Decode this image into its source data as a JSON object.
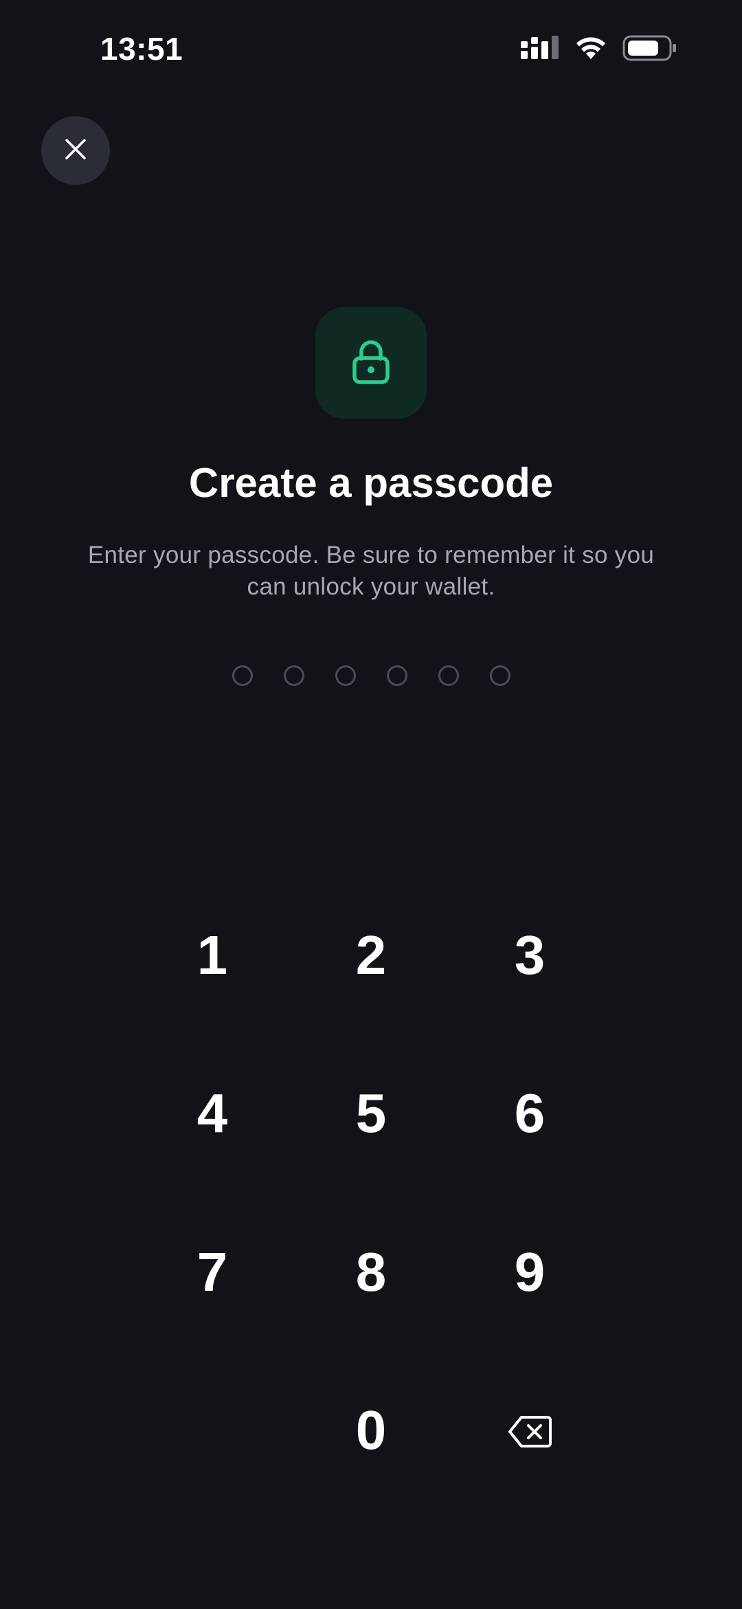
{
  "status_bar": {
    "time": "13:51",
    "icons": [
      "signal-icon",
      "wifi-icon",
      "battery-icon"
    ]
  },
  "header": {
    "close_icon": "close-icon"
  },
  "badge": {
    "icon": "lock-icon",
    "accent_color": "#2ecc8f",
    "background_color": "#0f2a23"
  },
  "title": "Create a passcode",
  "subtitle_line1": "Enter your passcode. Be sure to remember it so you",
  "subtitle_line2": "can unlock your wallet.",
  "passcode": {
    "length": 6,
    "filled": 0
  },
  "keypad": {
    "keys": [
      "1",
      "2",
      "3",
      "4",
      "5",
      "6",
      "7",
      "8",
      "9",
      "0"
    ],
    "backspace_icon": "backspace-icon"
  }
}
